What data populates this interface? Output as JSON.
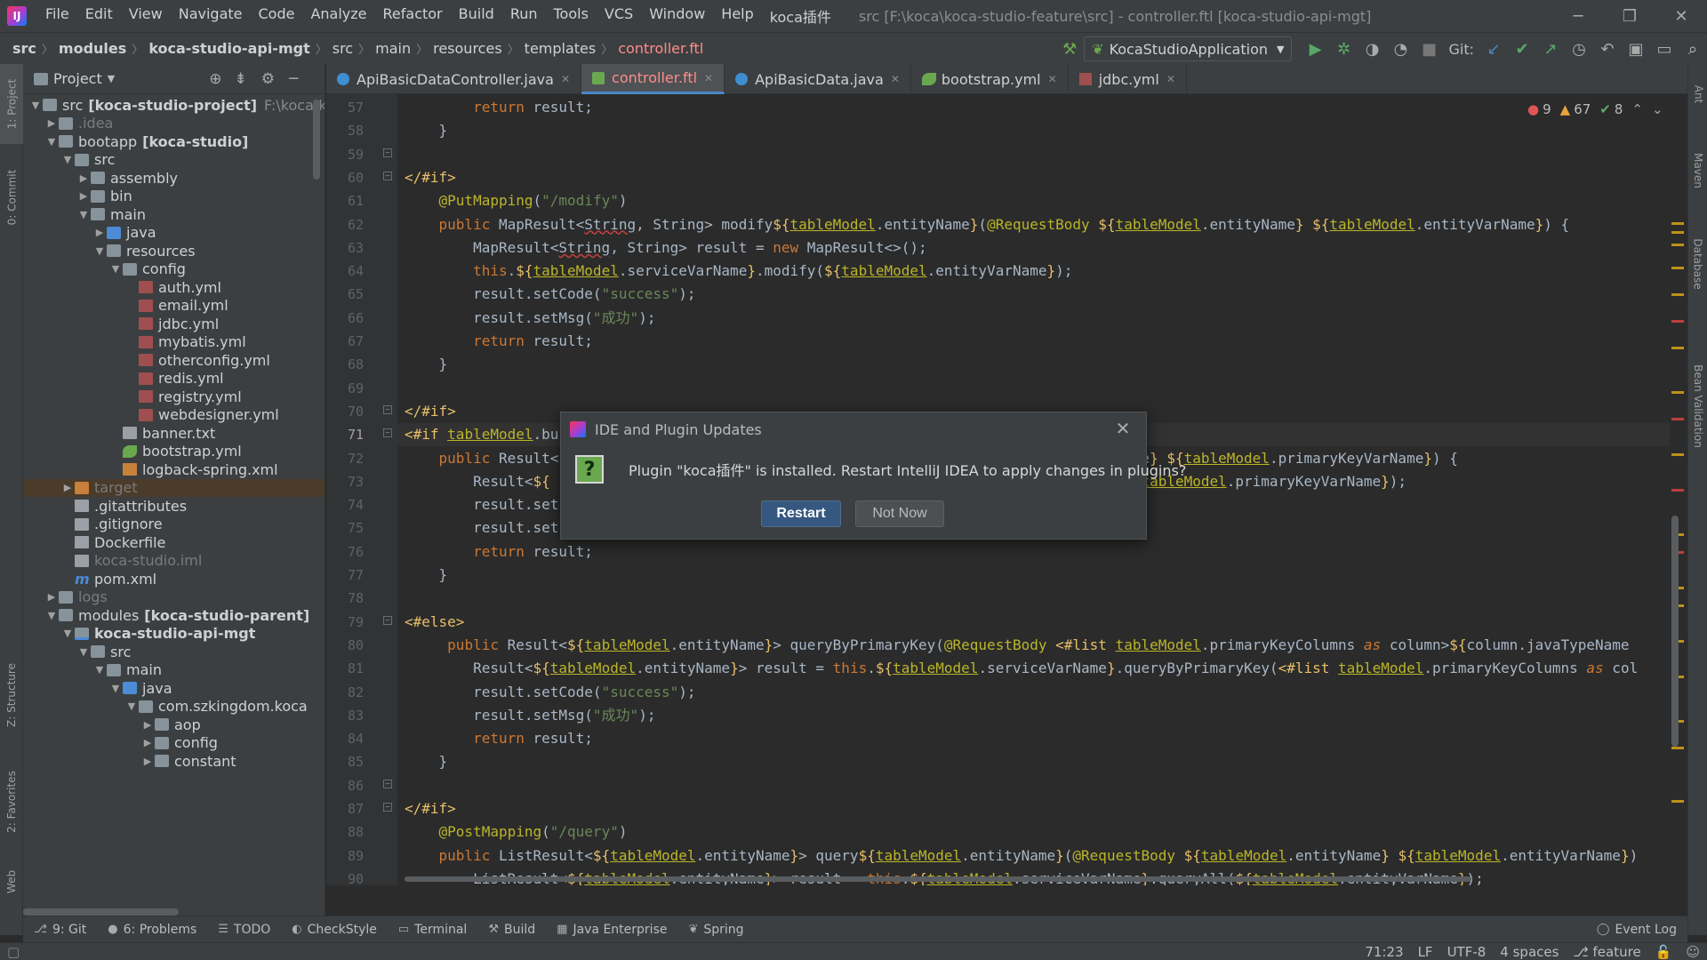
{
  "menubar": {
    "items": [
      "File",
      "Edit",
      "View",
      "Navigate",
      "Code",
      "Analyze",
      "Refactor",
      "Build",
      "Run",
      "Tools",
      "VCS",
      "Window",
      "Help",
      "koca插件"
    ],
    "window_title": "src [F:\\koca\\koca-studio-feature\\src] - controller.ftl [koca-studio-api-mgt]"
  },
  "breadcrumbs": [
    "src",
    "modules",
    "koca-studio-api-mgt",
    "src",
    "main",
    "resources",
    "templates",
    "controller.ftl"
  ],
  "run_config": "KocaStudioApplication",
  "git_label": "Git:",
  "project_panel": {
    "title": "Project"
  },
  "tree": [
    {
      "arrow": "v",
      "indent": 0,
      "icon": "folder",
      "label": "src",
      "extra": "[koca-studio-project]",
      "dim": "F:\\koca\\koca"
    },
    {
      "arrow": ">",
      "indent": 1,
      "icon": "folder",
      "label": ".idea",
      "cls": "gray"
    },
    {
      "arrow": "v",
      "indent": 1,
      "icon": "folder",
      "label": "bootapp",
      "extra": "[koca-studio]"
    },
    {
      "arrow": "v",
      "indent": 2,
      "icon": "folder",
      "label": "src"
    },
    {
      "arrow": ">",
      "indent": 3,
      "icon": "folder",
      "label": "assembly"
    },
    {
      "arrow": ">",
      "indent": 3,
      "icon": "folder",
      "label": "bin"
    },
    {
      "arrow": "v",
      "indent": 3,
      "icon": "folder",
      "label": "main"
    },
    {
      "arrow": ">",
      "indent": 4,
      "icon": "folder blue",
      "label": "java"
    },
    {
      "arrow": "v",
      "indent": 4,
      "icon": "folder",
      "label": "resources"
    },
    {
      "arrow": "v",
      "indent": 5,
      "icon": "folder",
      "label": "config"
    },
    {
      "arrow": "",
      "indent": 6,
      "icon": "yml",
      "label": "auth.yml"
    },
    {
      "arrow": "",
      "indent": 6,
      "icon": "yml",
      "label": "email.yml"
    },
    {
      "arrow": "",
      "indent": 6,
      "icon": "yml",
      "label": "jdbc.yml"
    },
    {
      "arrow": "",
      "indent": 6,
      "icon": "yml",
      "label": "mybatis.yml"
    },
    {
      "arrow": "",
      "indent": 6,
      "icon": "yml",
      "label": "otherconfig.yml"
    },
    {
      "arrow": "",
      "indent": 6,
      "icon": "yml",
      "label": "redis.yml"
    },
    {
      "arrow": "",
      "indent": 6,
      "icon": "yml",
      "label": "registry.yml"
    },
    {
      "arrow": "",
      "indent": 6,
      "icon": "yml",
      "label": "webdesigner.yml"
    },
    {
      "arrow": "",
      "indent": 5,
      "icon": "txt",
      "label": "banner.txt"
    },
    {
      "arrow": "",
      "indent": 5,
      "icon": "spring",
      "label": "bootstrap.yml"
    },
    {
      "arrow": "",
      "indent": 5,
      "icon": "xml",
      "label": "logback-spring.xml"
    },
    {
      "arrow": ">",
      "indent": 2,
      "icon": "folder orange",
      "label": "target",
      "cls": "gray",
      "sel": true
    },
    {
      "arrow": "",
      "indent": 2,
      "icon": "txt",
      "label": ".gitattributes"
    },
    {
      "arrow": "",
      "indent": 2,
      "icon": "txt",
      "label": ".gitignore"
    },
    {
      "arrow": "",
      "indent": 2,
      "icon": "txt",
      "label": "Dockerfile"
    },
    {
      "arrow": "",
      "indent": 2,
      "icon": "txt",
      "label": "koca-studio.iml",
      "cls": "gray"
    },
    {
      "arrow": "",
      "indent": 2,
      "icon": "m",
      "label": "pom.xml"
    },
    {
      "arrow": ">",
      "indent": 1,
      "icon": "folder",
      "label": "logs",
      "cls": "gray"
    },
    {
      "arrow": "v",
      "indent": 1,
      "icon": "folder",
      "label": "modules",
      "extra": "[koca-studio-parent]"
    },
    {
      "arrow": "v",
      "indent": 2,
      "icon": "folder mod",
      "label": "koca-studio-api-mgt",
      "cls": "bold"
    },
    {
      "arrow": "v",
      "indent": 3,
      "icon": "folder",
      "label": "src"
    },
    {
      "arrow": "v",
      "indent": 4,
      "icon": "folder",
      "label": "main"
    },
    {
      "arrow": "v",
      "indent": 5,
      "icon": "folder blue",
      "label": "java"
    },
    {
      "arrow": "v",
      "indent": 6,
      "icon": "pkg",
      "label": "com.szkingdom.koca"
    },
    {
      "arrow": ">",
      "indent": 7,
      "icon": "pkg",
      "label": "aop"
    },
    {
      "arrow": ">",
      "indent": 7,
      "icon": "pkg",
      "label": "config"
    },
    {
      "arrow": ">",
      "indent": 7,
      "icon": "pkg",
      "label": "constant"
    }
  ],
  "editor_tabs": [
    {
      "label": "ApiBasicDataController.java",
      "icon": "java"
    },
    {
      "label": "controller.ftl",
      "icon": "ftl",
      "active": true
    },
    {
      "label": "ApiBasicData.java",
      "icon": "java"
    },
    {
      "label": "bootstrap.yml",
      "icon": "spring"
    },
    {
      "label": "jdbc.yml",
      "icon": "yml"
    }
  ],
  "inspections": {
    "errors": "9",
    "warnings": "67",
    "weak": "8"
  },
  "code_lines": [
    {
      "n": "57",
      "html": "        <span class=\"k\">return</span> result;"
    },
    {
      "n": "58",
      "html": "    }"
    },
    {
      "n": "59",
      "html": ""
    },
    {
      "n": "60",
      "html": "<span class=\"t\">&lt;/#if&gt;</span>"
    },
    {
      "n": "61",
      "html": "    <span class=\"a\">@PutMapping</span>(<span class=\"s\">\"/modify\"</span>)"
    },
    {
      "n": "62",
      "html": "    <span class=\"k\">public</span> MapResult&lt;<span class=\"sq\">String</span>, String&gt; modify<span class=\"t\">${</span><span class=\"u\">tableModel</span>.entityName<span class=\"t\">}</span>(<span class=\"a\">@RequestBody</span> <span class=\"t\">${</span><span class=\"u\">tableModel</span>.entityName<span class=\"t\">}</span> <span class=\"t\">${</span><span class=\"u\">tableModel</span>.entityVarName<span class=\"t\">}</span>) {"
    },
    {
      "n": "63",
      "html": "        MapResult&lt;<span class=\"sq\">String</span>, String&gt; result = <span class=\"k\">new</span> MapResult&lt;&gt;();"
    },
    {
      "n": "64",
      "html": "        <span class=\"k\">this</span>.<span class=\"t\">${</span><span class=\"u\">tableModel</span>.serviceVarName<span class=\"t\">}</span>.modify(<span class=\"t\">${</span><span class=\"u\">tableModel</span>.entityVarName<span class=\"t\">}</span>);"
    },
    {
      "n": "65",
      "html": "        result.setCode(<span class=\"s\">\"success\"</span>);"
    },
    {
      "n": "66",
      "html": "        result.setMsg(<span class=\"s\">\"成功\"</span>);"
    },
    {
      "n": "67",
      "html": "        <span class=\"k\">return</span> result;"
    },
    {
      "n": "68",
      "html": "    }"
    },
    {
      "n": "69",
      "html": ""
    },
    {
      "n": "70",
      "html": "<span class=\"t\">&lt;/#if&gt;</span>"
    },
    {
      "n": "71",
      "html": "<span class=\"t\">&lt;#if</span> <span class=\"u\">tableModel</span>.bu",
      "cur": true
    },
    {
      "n": "72",
      "html": "    <span class=\"k\">public</span> Result&lt;                                                  <span class=\"u\">odel</span>.primaryKeyName<span class=\"t\">}</span> <span class=\"t\">${</span><span class=\"u\">tableModel</span>.primaryKeyVarName<span class=\"t\">}</span>) {"
    },
    {
      "n": "73",
      "html": "        Result&lt;<span class=\"t\">${</span>                                                .queryByPrimaryKey(<span class=\"t\">${</span><span class=\"u\">tableModel</span>.primaryKeyVarName<span class=\"t\">}</span>);"
    },
    {
      "n": "74",
      "html": "        result.set"
    },
    {
      "n": "75",
      "html": "        result.set"
    },
    {
      "n": "76",
      "html": "        <span class=\"k\">return</span> result;"
    },
    {
      "n": "77",
      "html": "    }"
    },
    {
      "n": "78",
      "html": ""
    },
    {
      "n": "79",
      "html": "<span class=\"t\">&lt;#else&gt;</span>"
    },
    {
      "n": "80",
      "html": "     <span class=\"k\">public</span> Result&lt;<span class=\"t\">${</span><span class=\"u\">tableModel</span>.entityName<span class=\"t\">}</span>&gt; queryByPrimaryKey(<span class=\"a\">@RequestBody</span> <span class=\"t\">&lt;#list</span> <span class=\"u\">tableModel</span>.primaryKeyColumns <span class=\"it\">as</span> column&gt;<span class=\"t\">${</span>column.javaTypeName"
    },
    {
      "n": "81",
      "html": "        Result&lt;<span class=\"t\">${</span><span class=\"u\">tableModel</span>.entityName<span class=\"t\">}</span>&gt; result = <span class=\"k\">this</span>.<span class=\"t\">${</span><span class=\"u\">tableModel</span>.serviceVarName<span class=\"t\">}</span>.queryByPrimaryKey(<span class=\"t\">&lt;#list</span> <span class=\"u\">tableModel</span>.primaryKeyColumns <span class=\"it\">as</span> col"
    },
    {
      "n": "82",
      "html": "        result.setCode(<span class=\"s\">\"success\"</span>);"
    },
    {
      "n": "83",
      "html": "        result.setMsg(<span class=\"s\">\"成功\"</span>);"
    },
    {
      "n": "84",
      "html": "        <span class=\"k\">return</span> result;"
    },
    {
      "n": "85",
      "html": "    }"
    },
    {
      "n": "86",
      "html": ""
    },
    {
      "n": "87",
      "html": "<span class=\"t\">&lt;/#if&gt;</span>"
    },
    {
      "n": "88",
      "html": "    <span class=\"a\">@PostMapping</span>(<span class=\"s\">\"/query\"</span>)"
    },
    {
      "n": "89",
      "html": "    <span class=\"k\">public</span> ListResult&lt;<span class=\"t\">${</span><span class=\"u\">tableModel</span>.entityName<span class=\"t\">}</span>&gt; query<span class=\"t\">${</span><span class=\"u\">tableModel</span>.entityName<span class=\"t\">}</span>(<span class=\"a\">@RequestBody</span> <span class=\"t\">${</span><span class=\"u\">tableModel</span>.entityName<span class=\"t\">}</span> <span class=\"t\">${</span><span class=\"u\">tableModel</span>.entityVarName<span class=\"t\">}</span>)"
    },
    {
      "n": "90",
      "html": "        ListResult&lt;<span class=\"t\">${</span><span class=\"u\">tableModel</span>.entityName<span class=\"t\">}</span>&gt; result = <span class=\"k\">this</span>.<span class=\"t\">${</span><span class=\"u\">tableModel</span>.serviceVarName<span class=\"t\">}</span>.queryAll(<span class=\"t\">${</span><span class=\"u\">tableModel</span>.entityVarName<span class=\"t\">}</span>);"
    }
  ],
  "dialog": {
    "title": "IDE and Plugin Updates",
    "message": "Plugin \"koca插件\" is installed. Restart IntelliJ IDEA to apply changes in plugins?",
    "restart": "Restart",
    "not_now": "Not Now"
  },
  "left_tabs": [
    "1: Project",
    "0: Commit",
    "Z: Structure",
    "2: Favorites",
    "Web"
  ],
  "right_tabs": [
    "Ant",
    "Maven",
    "Database",
    "Bean Validation"
  ],
  "tool_windows": [
    {
      "icon": "⎇",
      "label": "9: Git"
    },
    {
      "icon": "●",
      "label": "6: Problems"
    },
    {
      "icon": "☰",
      "label": "TODO"
    },
    {
      "icon": "◐",
      "label": "CheckStyle"
    },
    {
      "icon": "▭",
      "label": "Terminal"
    },
    {
      "icon": "⚒",
      "label": "Build"
    },
    {
      "icon": "▦",
      "label": "Java Enterprise"
    },
    {
      "icon": "❦",
      "label": "Spring"
    }
  ],
  "event_log": "Event Log",
  "status": {
    "position": "71:23",
    "line_sep": "LF",
    "encoding": "UTF-8",
    "indent": "4 spaces",
    "branch": "feature"
  },
  "colors": {
    "accent": "#4a88c7",
    "restart_button": "#365880"
  }
}
